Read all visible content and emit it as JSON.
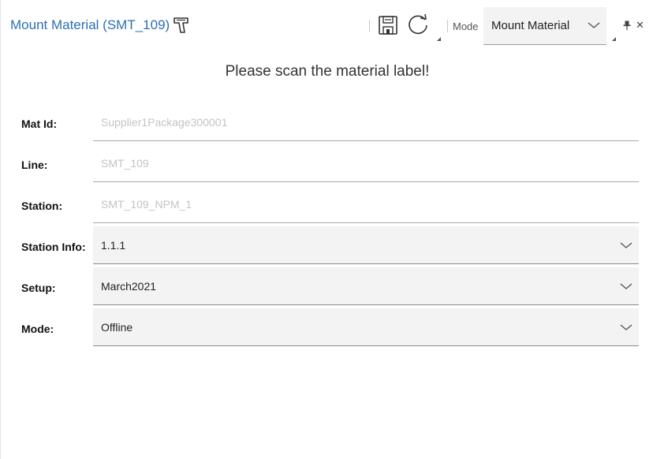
{
  "header": {
    "title": "Mount Material (SMT_109)",
    "mode_label": "Mode",
    "mode_value": "Mount Material"
  },
  "instruction": "Please scan the material label!",
  "form": {
    "mat_id": {
      "label": "Mat Id:",
      "placeholder": "Supplier1Package300001"
    },
    "line": {
      "label": "Line:",
      "placeholder": "SMT_109"
    },
    "station": {
      "label": "Station:",
      "placeholder": "SMT_109_NPM_1"
    },
    "station_info": {
      "label": "Station Info:",
      "value": "1.1.1"
    },
    "setup": {
      "label": "Setup:",
      "value": "March2021"
    },
    "mode": {
      "label": "Mode:",
      "value": "Offline"
    }
  },
  "colors": {
    "title": "#2c6fb3",
    "field_bg": "#f3f3f3",
    "placeholder": "#c4c4c4"
  },
  "icons": [
    "barcode-scanner-icon",
    "save-icon",
    "refresh-icon",
    "chevron-down-icon",
    "pin-icon",
    "close-icon"
  ]
}
